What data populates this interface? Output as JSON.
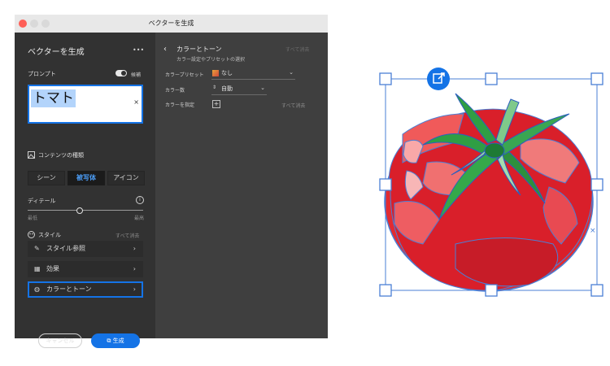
{
  "window": {
    "title": "ベクターを生成"
  },
  "left": {
    "panel_title": "ベクターを生成",
    "more": "•••",
    "prompt_label": "プロンプト",
    "candidates_label": "候補",
    "prompt_value": "トマト",
    "content_type_label": "コンテンツの種類",
    "content_types": [
      "シーン",
      "被写体",
      "アイコン"
    ],
    "selected_content_type": "被写体",
    "detail_label": "ディテール",
    "detail_min": "最低",
    "detail_max": "最高",
    "detail_level": 0.45,
    "style_label": "スタイル",
    "clear_all": "すべて消去",
    "style_items": [
      "スタイル参照",
      "効果",
      "カラーとトーン"
    ],
    "cancel_label": "キャンセル",
    "generate_label": "生成"
  },
  "right": {
    "back": "‹",
    "title": "カラーとトーン",
    "subtitle": "カラー設定やプリセットの選択",
    "clear_all": "すべて消去",
    "preset_label": "カラープリセット",
    "preset_value": "なし",
    "count_label": "カラー数",
    "count_value": "自動",
    "specify_label": "カラーを指定",
    "specify_clear": "すべて消去"
  },
  "colors": {
    "accent": "#1473e6",
    "tomato": "#e32b31",
    "leaf": "#2f9e44",
    "outline": "#4a7fd6"
  }
}
